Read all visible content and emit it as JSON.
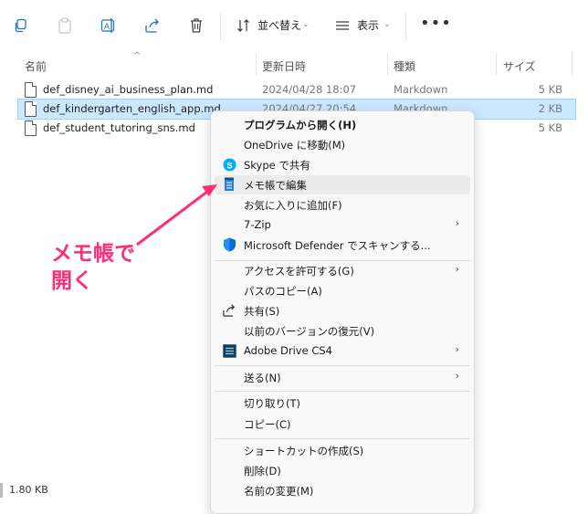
{
  "toolbar": {
    "sort_label": "並べ替え",
    "view_label": "表示",
    "more_label": "•••"
  },
  "columns": {
    "name": "名前",
    "modified": "更新日時",
    "type": "種類",
    "size": "サイズ"
  },
  "files": [
    {
      "name": "def_disney_ai_business_plan.md",
      "modified": "2024/04/28 18:07",
      "type": "Markdown",
      "size": "5 KB"
    },
    {
      "name": "def_kindergarten_english_app.md",
      "modified": "2024/04/27 20:54",
      "type": "Markdown",
      "size": "2 KB"
    },
    {
      "name": "def_student_tutoring_sns.md",
      "modified": "",
      "type": "",
      "size": "5 KB"
    }
  ],
  "context_menu": {
    "items": [
      {
        "label": "プログラムから開く(H)",
        "icon": "none"
      },
      {
        "label": "OneDrive に移動(M)",
        "icon": "none"
      },
      {
        "label": "Skype で共有",
        "icon": "skype-icon"
      },
      {
        "label": "メモ帳で編集",
        "icon": "notepad-icon"
      },
      {
        "label": "お気に入りに追加(F)",
        "icon": "none"
      },
      {
        "label": "7-Zip",
        "icon": "none"
      },
      {
        "label": "Microsoft Defender でスキャンする...",
        "icon": "defender-shield-icon"
      },
      {
        "label": "アクセスを許可する(G)",
        "icon": "none"
      },
      {
        "label": "パスのコピー(A)",
        "icon": "none"
      },
      {
        "label": "共有(S)",
        "icon": "share-icon"
      },
      {
        "label": "以前のバージョンの復元(V)",
        "icon": "none"
      },
      {
        "label": "Adobe Drive CS4",
        "icon": "adobe-drive-icon"
      },
      {
        "label": "送る(N)",
        "icon": "none"
      },
      {
        "label": "切り取り(T)",
        "icon": "none"
      },
      {
        "label": "コピー(C)",
        "icon": "none"
      },
      {
        "label": "ショートカットの作成(S)",
        "icon": "none"
      },
      {
        "label": "削除(D)",
        "icon": "none"
      },
      {
        "label": "名前の変更(M)",
        "icon": "none"
      }
    ]
  },
  "status": {
    "size_text": "1.80 KB"
  },
  "annotation": {
    "line1": "メモ帳で",
    "line2": "開く",
    "color": "#ff2d78"
  },
  "colors": {
    "selection": "#cce8ff",
    "menu_bg": "#f9f9f9",
    "skype": "#00aff0",
    "defender": "#0a6ed1"
  }
}
